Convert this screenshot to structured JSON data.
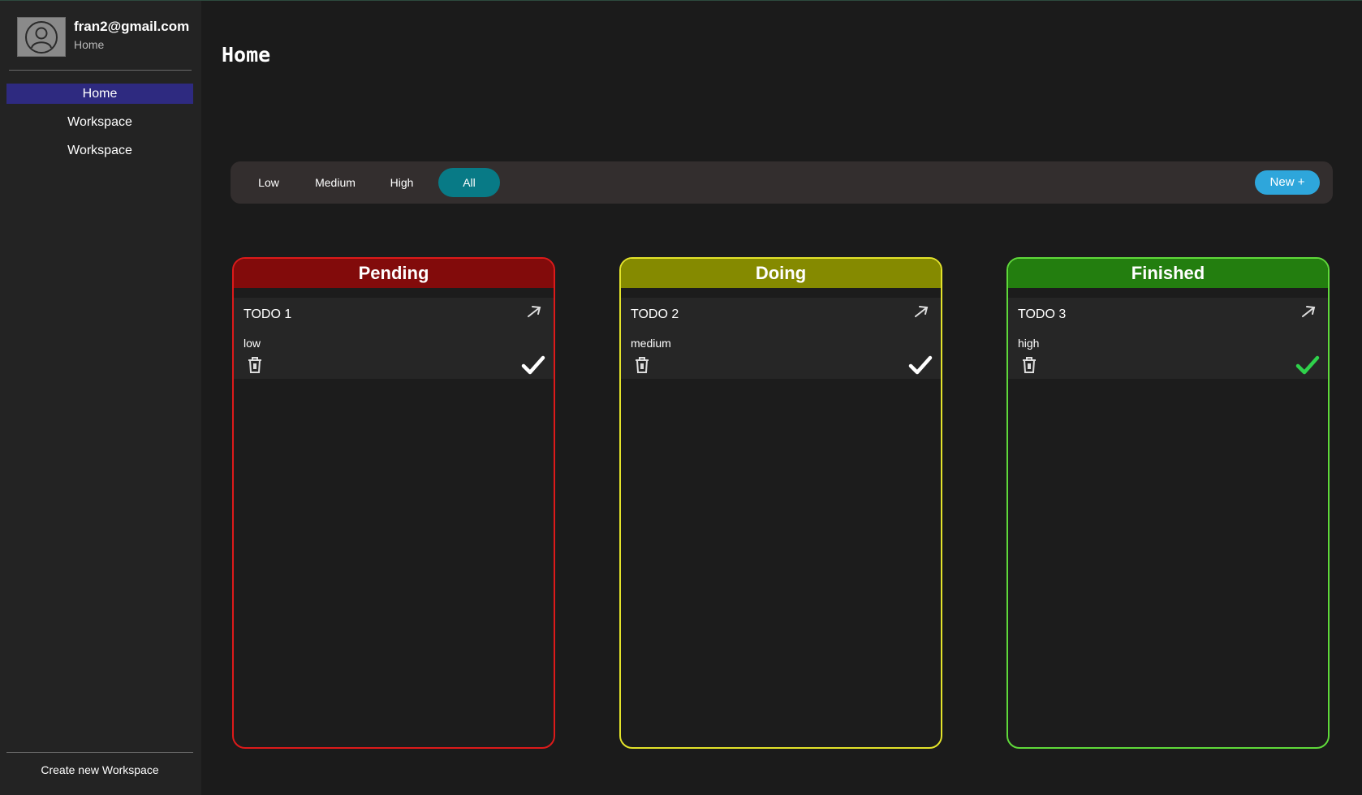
{
  "profile": {
    "email": "fran2@gmail.com",
    "subtitle": "Home",
    "avatar_icon": "user-avatar-icon"
  },
  "sidebar": {
    "items": [
      {
        "label": "Home",
        "active": true
      },
      {
        "label": "Workspace",
        "active": false
      },
      {
        "label": "Workspace",
        "active": false
      }
    ],
    "create_label": "Create new Workspace",
    "active_color": "#2e2a80"
  },
  "page": {
    "title": "Home"
  },
  "toolbar": {
    "filters": [
      {
        "label": "Low",
        "active": false
      },
      {
        "label": "Medium",
        "active": false
      },
      {
        "label": "High",
        "active": false
      },
      {
        "label": "All",
        "active": true
      }
    ],
    "new_label": "New +",
    "active_filter_color": "#087a86",
    "new_button_color": "#2ea6db"
  },
  "columns": [
    {
      "title": "Pending",
      "border_color": "#dd1a1a",
      "header_color": "#820b0b",
      "cards": [
        {
          "title": "TODO 1",
          "priority": "low",
          "done": false
        }
      ]
    },
    {
      "title": "Doing",
      "border_color": "#e3e32a",
      "header_color": "#858a00",
      "cards": [
        {
          "title": "TODO 2",
          "priority": "medium",
          "done": false
        }
      ]
    },
    {
      "title": "Finished",
      "border_color": "#5fd93a",
      "header_color": "#237e0f",
      "cards": [
        {
          "title": "TODO 3",
          "priority": "high",
          "done": true
        }
      ]
    }
  ],
  "icons": {
    "open": "arrow-up-right-icon",
    "delete": "trash-icon",
    "complete": "check-icon"
  }
}
